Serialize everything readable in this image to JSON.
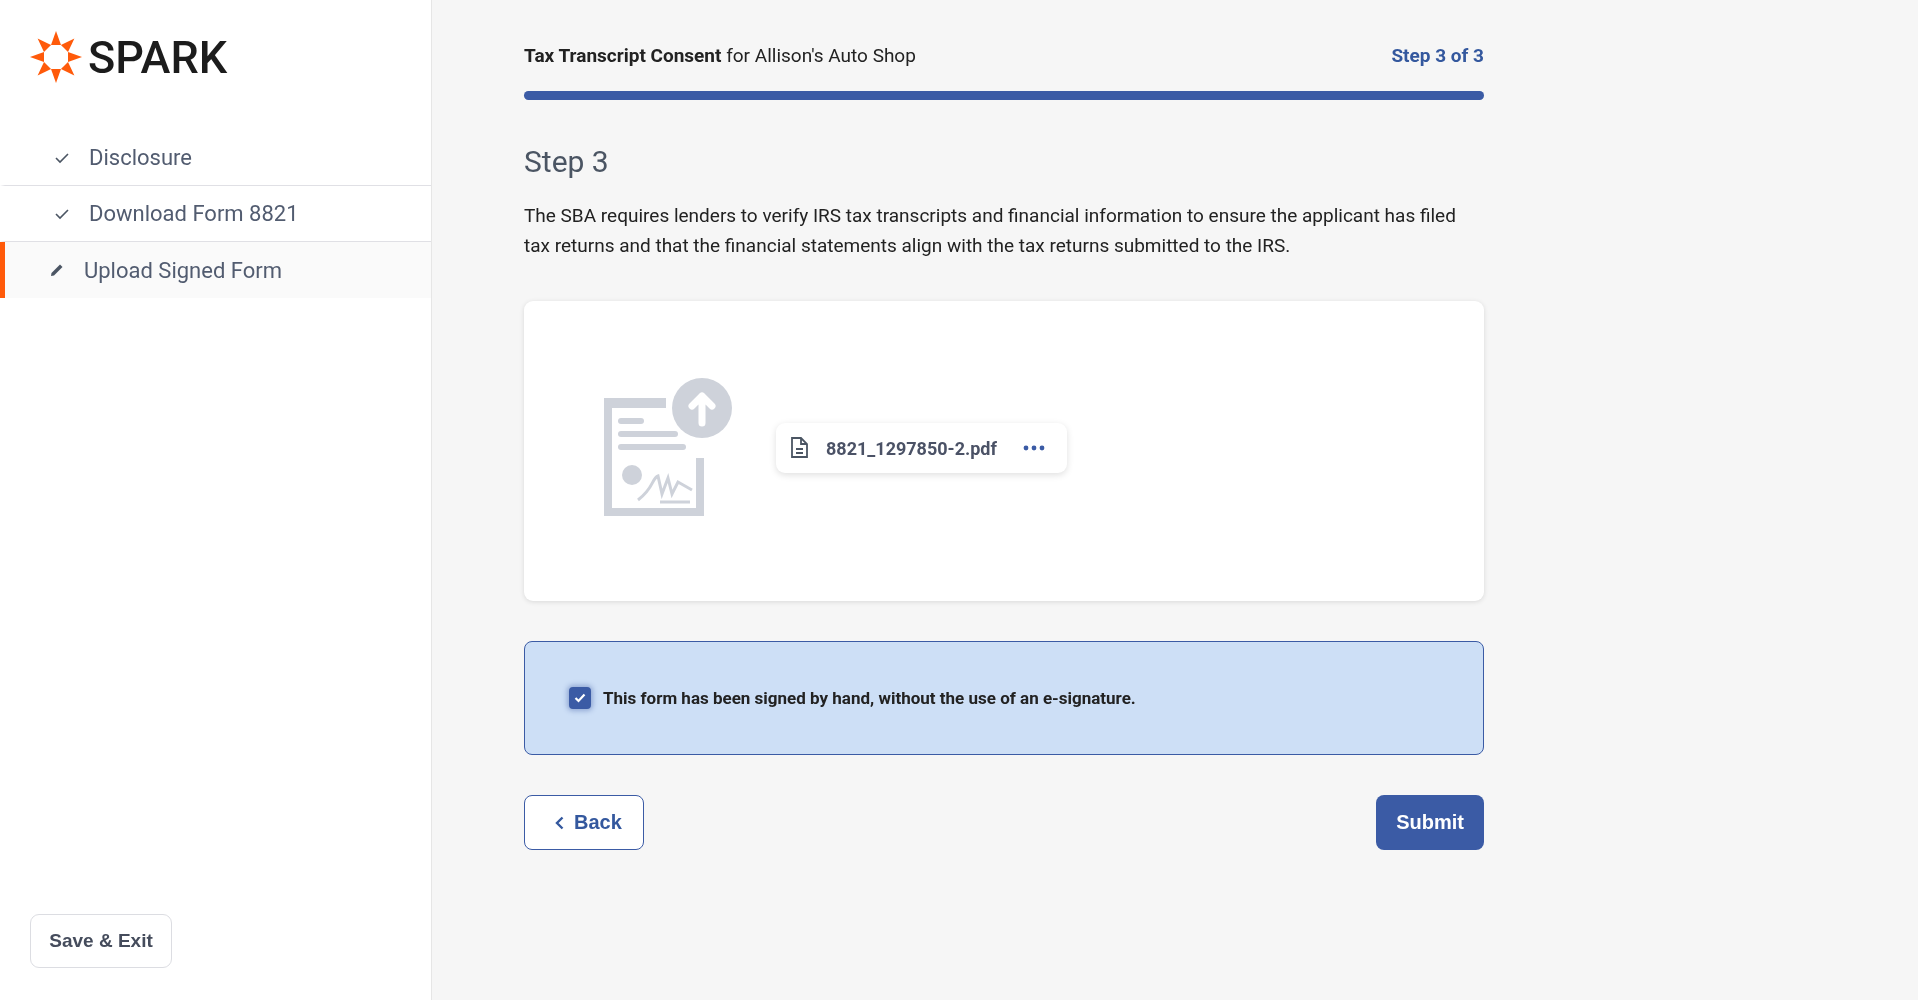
{
  "brand": {
    "name": "SPARK"
  },
  "steps": [
    {
      "label": "Disclosure",
      "kind": "done",
      "selected": false
    },
    {
      "label": "Download Form 8821",
      "kind": "done",
      "selected": false
    },
    {
      "label": "Upload Signed Form",
      "kind": "current",
      "selected": true
    }
  ],
  "save_button": "Save & Exit",
  "header": {
    "title": "**Tax Transcript Consent** for Allison's Auto Shop",
    "step_count": "Step 3 of 3",
    "level": 1
  },
  "heading": "Step 3",
  "description": "The SBA requires lenders to verify IRS tax transcripts and financial information to ensure the applicant has filed tax returns and that the financial statements align with the tax returns submitted to the IRS.",
  "upload": {
    "file_name": "8821_1297850-2.pdf"
  },
  "confirmation": {
    "label": "This form has been signed by hand, without the use of an e-signature.",
    "checked": true
  },
  "buttons": {
    "back": "Back",
    "submit": "Submit"
  }
}
